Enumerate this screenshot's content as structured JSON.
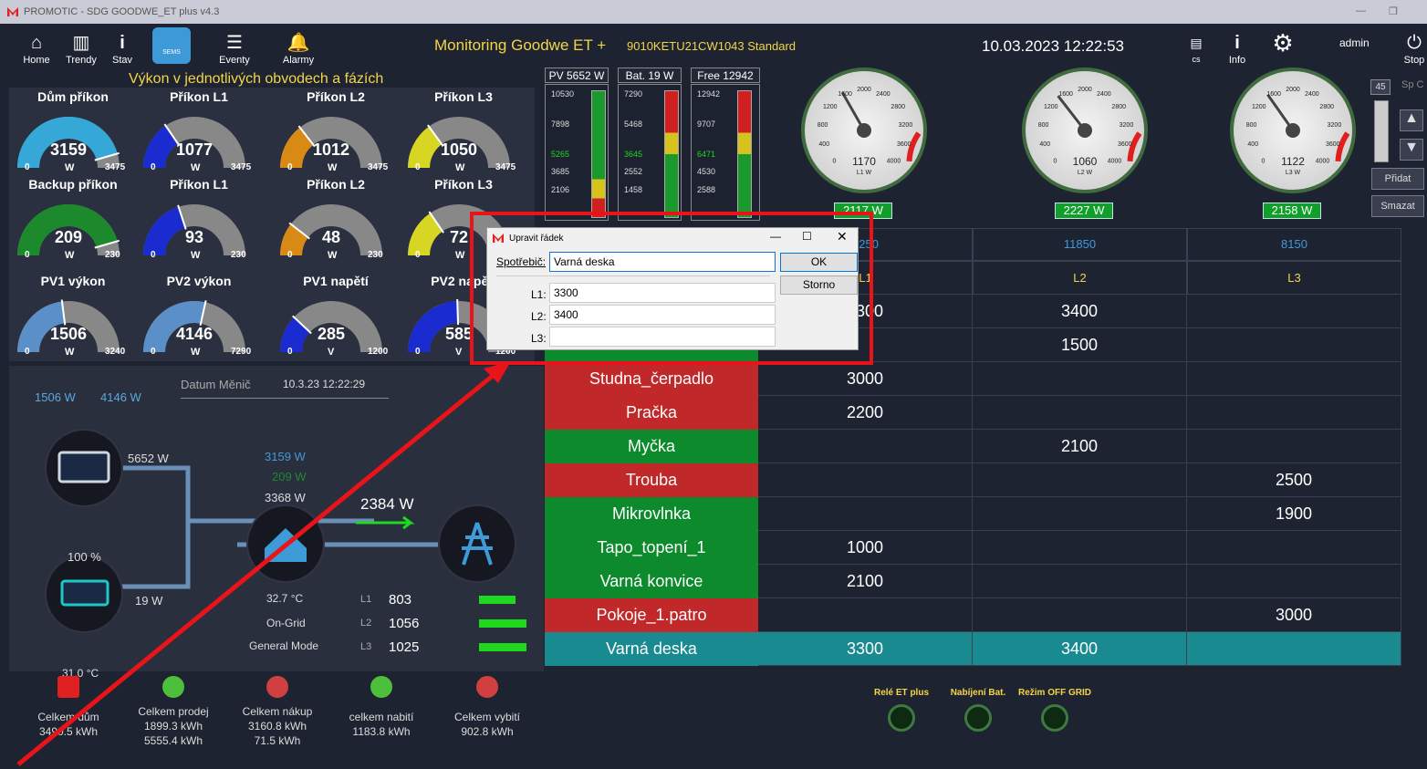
{
  "titlebar": {
    "title": "PROMOTIC - SDG GOODWE_ET plus  v4.3"
  },
  "toolbar": {
    "home": "Home",
    "trendy": "Trendy",
    "stav": "Stav",
    "sems": "SEMS",
    "eventy": "Eventy",
    "alarmy": "Alarmy",
    "lang": "cs",
    "info": "Info",
    "user": "admin",
    "stop": "Stop"
  },
  "header": {
    "title": "Monitoring Goodwe ET +",
    "serial": "9010KETU21CW1043 Standard",
    "datetime": "10.03.2023 12:22:53"
  },
  "section": {
    "title": "Výkon v jednotlivých obvodech a fázích"
  },
  "gauges_row1": [
    {
      "label": "Dům příkon",
      "value": "3159",
      "unit": "W",
      "min": "0",
      "max": "3475",
      "color": "#35a8d8",
      "fraction": 0.91
    },
    {
      "label": "Příkon L1",
      "value": "1077",
      "unit": "W",
      "min": "0",
      "max": "3475",
      "color": "#1a2bd0",
      "fraction": 0.31
    },
    {
      "label": "Příkon L2",
      "value": "1012",
      "unit": "W",
      "min": "0",
      "max": "3475",
      "color": "#d88a14",
      "fraction": 0.29
    },
    {
      "label": "Příkon L3",
      "value": "1050",
      "unit": "W",
      "min": "0",
      "max": "3475",
      "color": "#d6d623",
      "fraction": 0.3
    }
  ],
  "gauges_row2": [
    {
      "label": "Backup příkon",
      "value": "209",
      "unit": "W",
      "min": "0",
      "max": "230",
      "color": "#1c8a2c",
      "fraction": 0.91
    },
    {
      "label": "Příkon L1",
      "value": "93",
      "unit": "W",
      "min": "0",
      "max": "230",
      "color": "#1a2bd0",
      "fraction": 0.4
    },
    {
      "label": "Příkon L2",
      "value": "48",
      "unit": "W",
      "min": "0",
      "max": "230",
      "color": "#d88a14",
      "fraction": 0.21
    },
    {
      "label": "Příkon L3",
      "value": "72",
      "unit": "W",
      "min": "0",
      "max": "230",
      "color": "#d6d623",
      "fraction": 0.31
    }
  ],
  "gauges_row3": [
    {
      "label": "PV1 výkon",
      "value": "1506",
      "unit": "W",
      "min": "0",
      "max": "3240",
      "color": "#5b8fc8",
      "fraction": 0.46
    },
    {
      "label": "PV2 výkon",
      "value": "4146",
      "unit": "W",
      "min": "0",
      "max": "7290",
      "color": "#5b8fc8",
      "fraction": 0.57
    },
    {
      "label": "PV1 napětí",
      "value": "285",
      "unit": "V",
      "min": "0",
      "max": "1200",
      "color": "#1a2bd0",
      "fraction": 0.24
    },
    {
      "label": "PV2 napětí",
      "value": "585",
      "unit": "V",
      "min": "0",
      "max": "1200",
      "color": "#1a2bd0",
      "fraction": 0.49
    }
  ],
  "inverter": {
    "date_label": "Datum Měnič",
    "date_value": "10.3.23 12:22:29",
    "pv1": "1506 W",
    "pv2": "4146 W",
    "pv_total": "5652 W",
    "house1": "3159 W",
    "house2": "209 W",
    "house3": "3368 W",
    "grid": "2384 W",
    "soc": "100 %",
    "battery": "19 W",
    "temp_inv": "32.7 °C",
    "mode1": "On-Grid",
    "mode2": "General Mode",
    "batt_temp": "31.0 °C",
    "phases": [
      {
        "name": "L1",
        "value": "803"
      },
      {
        "name": "L2",
        "value": "1056"
      },
      {
        "name": "L3",
        "value": "1025"
      }
    ]
  },
  "bars": [
    {
      "header": "PV 5652 W",
      "ticks": [
        "10530",
        "7898",
        "5265",
        "3685",
        "2106"
      ]
    },
    {
      "header": "Bat. 19 W",
      "ticks": [
        "7290",
        "5468",
        "3645",
        "2552",
        "1458"
      ]
    },
    {
      "header": "Free 12942 W",
      "ticks": [
        "12942",
        "9707",
        "6471",
        "4530",
        "2588"
      ]
    }
  ],
  "dials": [
    {
      "value": "1170",
      "unit": "L1 W",
      "box": "2117 W",
      "fraction": 0.39
    },
    {
      "value": "1060",
      "unit": "L2 W",
      "box": "2227 W",
      "fraction": 0.36
    },
    {
      "value": "1122",
      "unit": "L3 W",
      "box": "2158 W",
      "fraction": 0.37
    }
  ],
  "dial_scale": [
    "0",
    "400",
    "800",
    "1200",
    "1600",
    "2000",
    "2400",
    "2800",
    "3200",
    "3600",
    "4000"
  ],
  "side": {
    "num": "45",
    "sp": "Sp C",
    "add": "Přidat",
    "del": "Smazat"
  },
  "table": {
    "totals": [
      "8250",
      "11850",
      "8150"
    ],
    "phases": [
      "L1",
      "L2",
      "L3"
    ],
    "rows": [
      {
        "name": "",
        "l1": "3300",
        "l2": "3400",
        "l3": "",
        "state": "green"
      },
      {
        "name": "",
        "l1": "",
        "l2": "1500",
        "l3": "",
        "state": "green"
      },
      {
        "name": "Studna_čerpadlo",
        "l1": "3000",
        "l2": "",
        "l3": "",
        "state": "red"
      },
      {
        "name": "Pračka",
        "l1": "2200",
        "l2": "",
        "l3": "",
        "state": "red"
      },
      {
        "name": "Myčka",
        "l1": "",
        "l2": "2100",
        "l3": "",
        "state": "green"
      },
      {
        "name": "Trouba",
        "l1": "",
        "l2": "",
        "l3": "2500",
        "state": "red"
      },
      {
        "name": "Mikrovlnka",
        "l1": "",
        "l2": "",
        "l3": "1900",
        "state": "green"
      },
      {
        "name": "Tapo_topení_1",
        "l1": "1000",
        "l2": "",
        "l3": "",
        "state": "green"
      },
      {
        "name": "Varná konvice",
        "l1": "2100",
        "l2": "",
        "l3": "",
        "state": "green"
      },
      {
        "name": "Pokoje_1.patro",
        "l1": "",
        "l2": "",
        "l3": "3000",
        "state": "red"
      },
      {
        "name": "Varná deska",
        "l1": "3300",
        "l2": "3400",
        "l3": "",
        "state": "teal"
      }
    ]
  },
  "dialog": {
    "title": "Upravit řádek",
    "spotrebic_label": "Spotřebič:",
    "spotrebic_value": "Varná deska",
    "l1_label": "L1:",
    "l1_value": "3300",
    "l2_label": "L2:",
    "l2_value": "3400",
    "l3_label": "L3:",
    "l3_value": "",
    "ok": "OK",
    "storno": "Storno"
  },
  "bottom": [
    {
      "title": "Celkem dům",
      "lines": [
        "3490.5 kWh"
      ]
    },
    {
      "title": "Celkem prodej",
      "lines": [
        "1899.3 kWh",
        "5555.4 kWh"
      ]
    },
    {
      "title": "Celkem nákup",
      "lines": [
        "3160.8 kWh",
        "71.5 kWh"
      ]
    },
    {
      "title": "celkem nabití",
      "lines": [
        "1183.8 kWh"
      ]
    },
    {
      "title": "Celkem vybití",
      "lines": [
        "902.8 kWh"
      ]
    }
  ],
  "relays": [
    "Relé ET plus",
    "Nabíjení Bat.",
    "Režim OFF GRID"
  ]
}
